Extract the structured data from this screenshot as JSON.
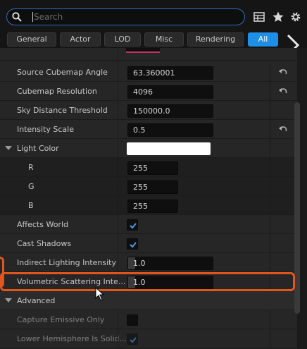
{
  "search": {
    "placeholder": "Search",
    "value": ""
  },
  "toolbar": {
    "icons": [
      "search-icon",
      "grid-view-icon",
      "star-icon",
      "settings-gear-icon"
    ]
  },
  "tabs": [
    {
      "label": "General"
    },
    {
      "label": "Actor"
    },
    {
      "label": "LOD"
    },
    {
      "label": "Misc"
    },
    {
      "label": "Rendering"
    },
    {
      "label": "All",
      "active": true
    }
  ],
  "properties": {
    "source_cubemap_angle": {
      "label": "Source Cubemap Angle",
      "value": "63.360001"
    },
    "cubemap_resolution": {
      "label": "Cubemap Resolution",
      "value": "4096"
    },
    "sky_distance_threshold": {
      "label": "Sky Distance Threshold",
      "value": "150000.0"
    },
    "intensity_scale": {
      "label": "Intensity Scale",
      "value": "0.5"
    },
    "light_color": {
      "label": "Light Color",
      "swatch": "#ffffff",
      "r": {
        "label": "R",
        "value": "255"
      },
      "g": {
        "label": "G",
        "value": "255"
      },
      "b": {
        "label": "B",
        "value": "255"
      }
    },
    "affects_world": {
      "label": "Affects World",
      "checked": true
    },
    "cast_shadows": {
      "label": "Cast Shadows",
      "checked": true
    },
    "indirect_lighting_intensity": {
      "label": "Indirect Lighting Intensity",
      "value": "1.0"
    },
    "volumetric_scattering_intensity": {
      "label": "Volumetric Scattering Inte...",
      "value": "1.0"
    }
  },
  "advanced": {
    "label": "Advanced",
    "capture_emissive_only": {
      "label": "Capture Emissive Only",
      "checked": false
    },
    "lower_hemisphere_is_solid": {
      "label": "Lower Hemisphere Is Solid...",
      "checked": true
    }
  },
  "colors": {
    "accent": "#1e8fe6",
    "highlight": "#e0561c",
    "check": "#4a9be8"
  }
}
